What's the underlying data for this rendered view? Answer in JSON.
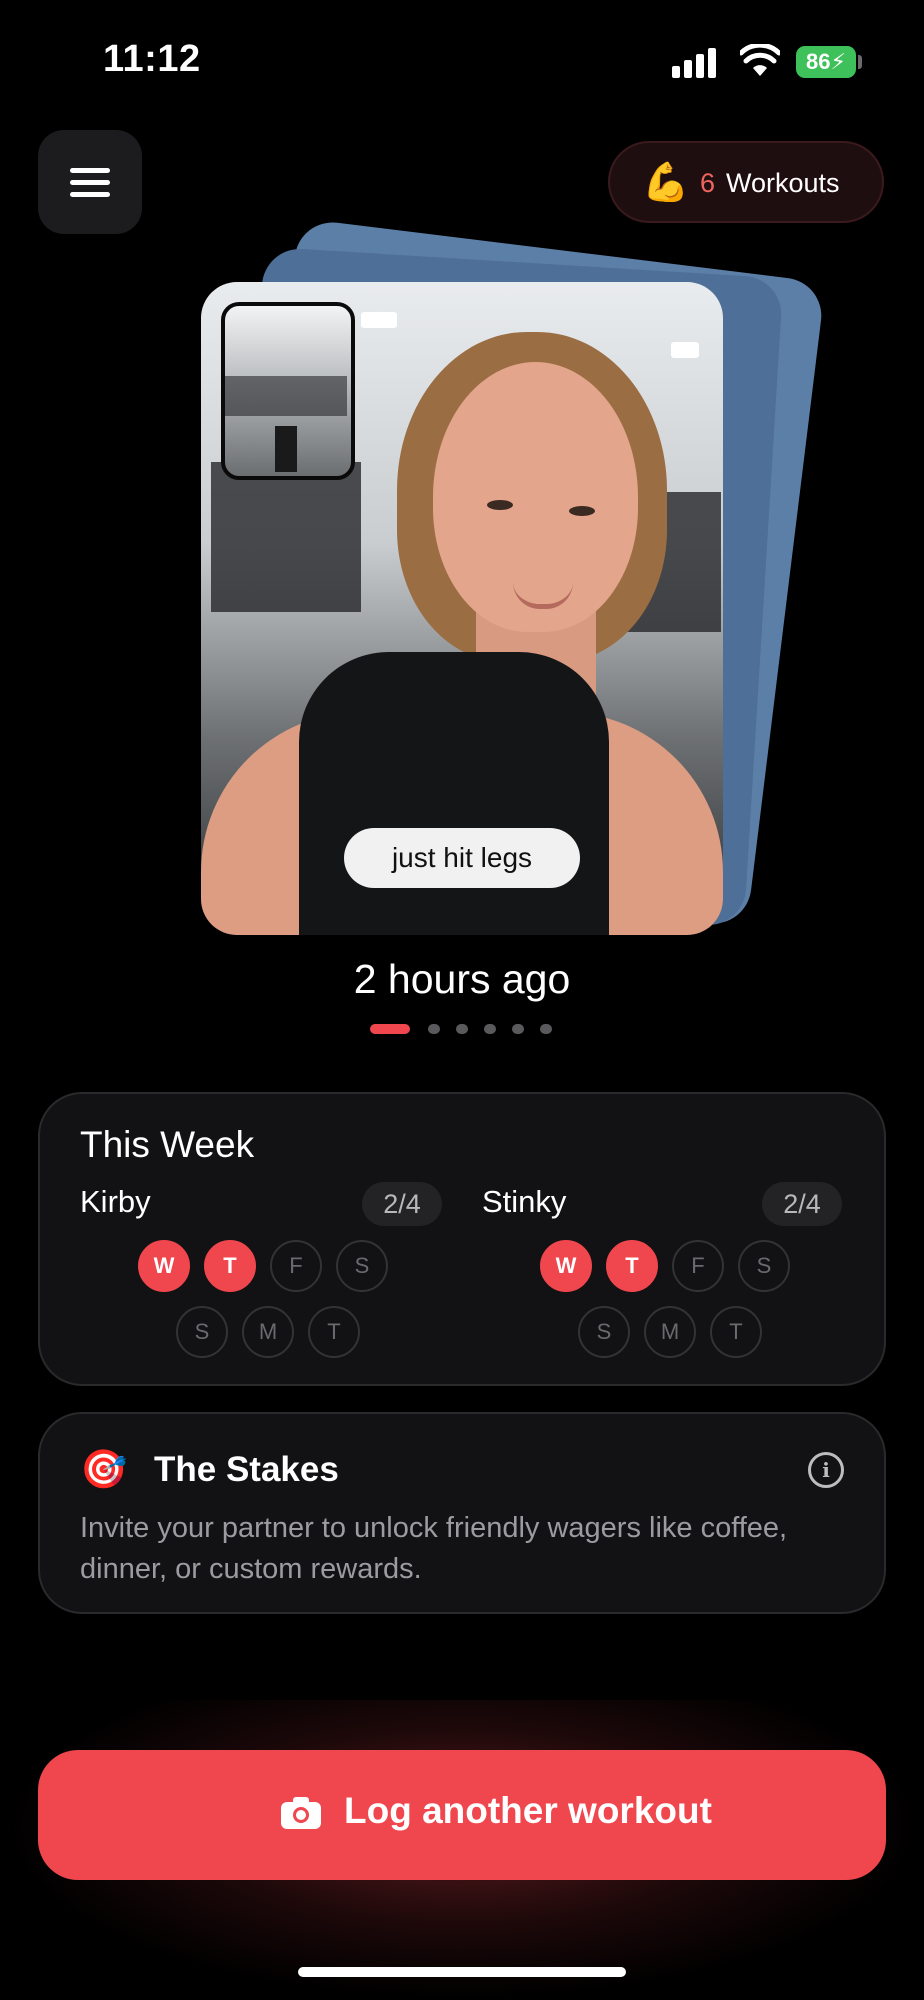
{
  "status_bar": {
    "time": "11:12",
    "battery_level": "86"
  },
  "header": {
    "workouts_emoji": "💪",
    "workouts_count": "6",
    "workouts_label": "Workouts"
  },
  "feed": {
    "caption": "just hit legs",
    "timestamp": "2 hours ago",
    "page_count": 6,
    "active_page": 1
  },
  "week": {
    "title": "This Week",
    "people": [
      {
        "name": "Kirby",
        "score": "2/4",
        "days": [
          "W",
          "T",
          "F",
          "S",
          "S",
          "M",
          "T"
        ],
        "done": [
          true,
          true,
          false,
          false,
          false,
          false,
          false
        ]
      },
      {
        "name": "Stinky",
        "score": "2/4",
        "days": [
          "W",
          "T",
          "F",
          "S",
          "S",
          "M",
          "T"
        ],
        "done": [
          true,
          true,
          false,
          false,
          false,
          false,
          false
        ]
      }
    ]
  },
  "stakes": {
    "icon": "🎯",
    "title": "The Stakes",
    "info_glyph": "i",
    "text": "Invite your partner to unlock friendly wagers like coffee, dinner, or custom rewards."
  },
  "cta": {
    "label": "Log another workout"
  },
  "colors": {
    "accent": "#f0464e",
    "card": "#121214",
    "background": "#000000"
  }
}
